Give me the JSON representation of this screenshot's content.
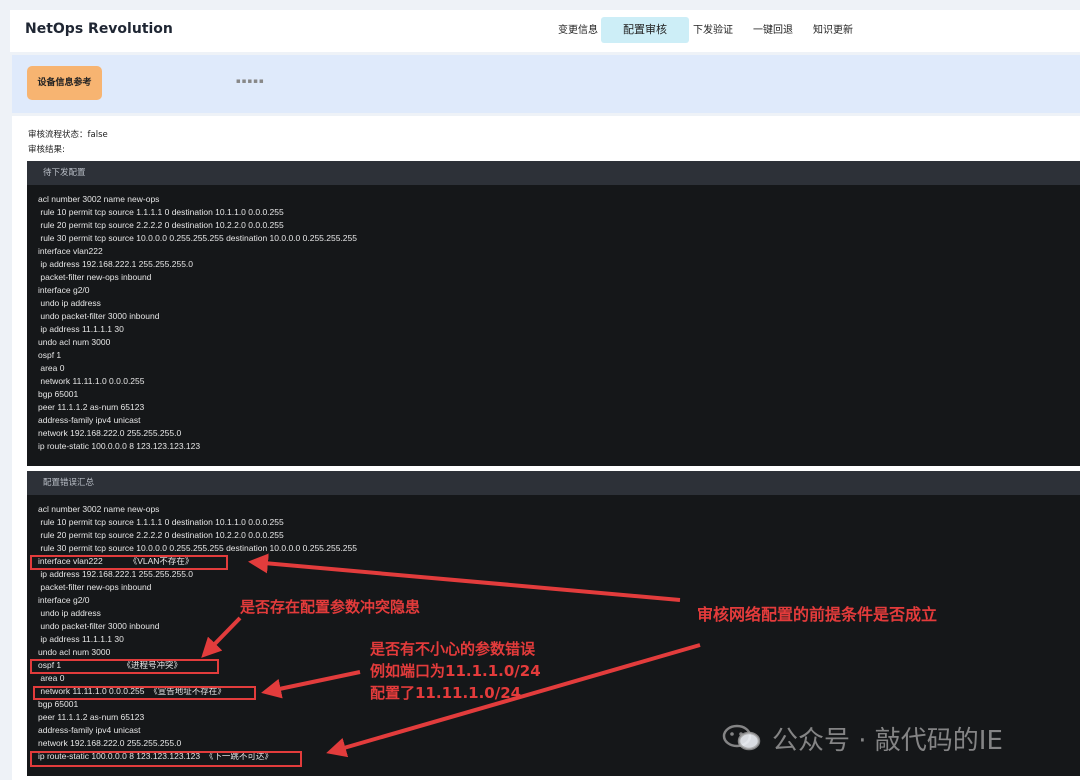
{
  "app": {
    "title": "NetOps Revolution"
  },
  "nav": {
    "items": [
      {
        "label": "变更信息"
      },
      {
        "label": "配置审核"
      },
      {
        "label": "下发验证"
      },
      {
        "label": "一键回退"
      },
      {
        "label": "知识更新"
      }
    ],
    "active": "配置审核"
  },
  "banner": {
    "device_button": "设备信息参考",
    "dots": "▪▪▪▪▪"
  },
  "audit": {
    "status_label": "审核流程状态：false",
    "result_label": "审核结果:"
  },
  "pending": {
    "title": "待下发配置",
    "lines": [
      "acl number 3002 name new-ops",
      " rule 10 permit tcp source 1.1.1.1 0 destination 10.1.1.0 0.0.0.255",
      " rule 20 permit tcp source 2.2.2.2 0 destination 10.2.2.0 0.0.0.255",
      " rule 30 permit tcp source 10.0.0.0 0.255.255.255 destination 10.0.0.0 0.255.255.255",
      "interface vlan222",
      " ip address 192.168.222.1 255.255.255.0",
      " packet-filter new-ops inbound",
      "interface g2/0",
      " undo ip address",
      " undo packet-filter 3000 inbound",
      " ip address 11.1.1.1 30",
      "undo acl num 3000",
      "ospf 1",
      " area 0",
      " network 11.11.1.0 0.0.0.255",
      "bgp 65001",
      "peer 11.1.1.2 as-num 65123",
      "address-family ipv4 unicast",
      "network 192.168.222.0 255.255.255.0",
      "ip route-static 100.0.0.0 8 123.123.123.123"
    ]
  },
  "errors": {
    "title": "配置错误汇总",
    "lines": [
      "acl number 3002 name new-ops",
      " rule 10 permit tcp source 1.1.1.1 0 destination 10.1.1.0 0.0.0.255",
      " rule 20 permit tcp source 2.2.2.2 0 destination 10.2.2.0 0.0.0.255",
      " rule 30 permit tcp source 10.0.0.0 0.255.255.255 destination 10.0.0.0 0.255.255.255",
      "interface vlan222           《VLAN不存在》",
      " ip address 192.168.222.1 255.255.255.0",
      " packet-filter new-ops inbound",
      "interface g2/0",
      " undo ip address",
      " undo packet-filter 3000 inbound",
      " ip address 11.1.1.1 30",
      "undo acl num 3000",
      "ospf 1                          《进程号冲突》",
      " area 0",
      " network 11.11.1.0 0.0.0.255  《宣告地址不存在》",
      "bgp 65001",
      "peer 11.1.1.2 as-num 65123",
      "address-family ipv4 unicast",
      "network 192.168.222.0 255.255.255.0",
      "ip route-static 100.0.0.0 8 123.123.123.123  《下一跳不可达》"
    ]
  },
  "annotations": {
    "conflict": "是否存在配置参数冲突隐患",
    "prereq": "审核网络配置的前提条件是否成立",
    "param_error_1": "是否有不小心的参数错误",
    "param_error_2": "例如端口为11.1.1.0/24",
    "param_error_3": "配置了11.11.1.0/24"
  },
  "watermark": {
    "text": "公众号 · 敲代码的IE"
  },
  "colors": {
    "accent_red": "#e23c3c",
    "nav_active_bg": "#cdeef7",
    "device_button_bg": "#f7b471",
    "code_bg": "#151719",
    "panel_head_bg": "#2d3138"
  }
}
